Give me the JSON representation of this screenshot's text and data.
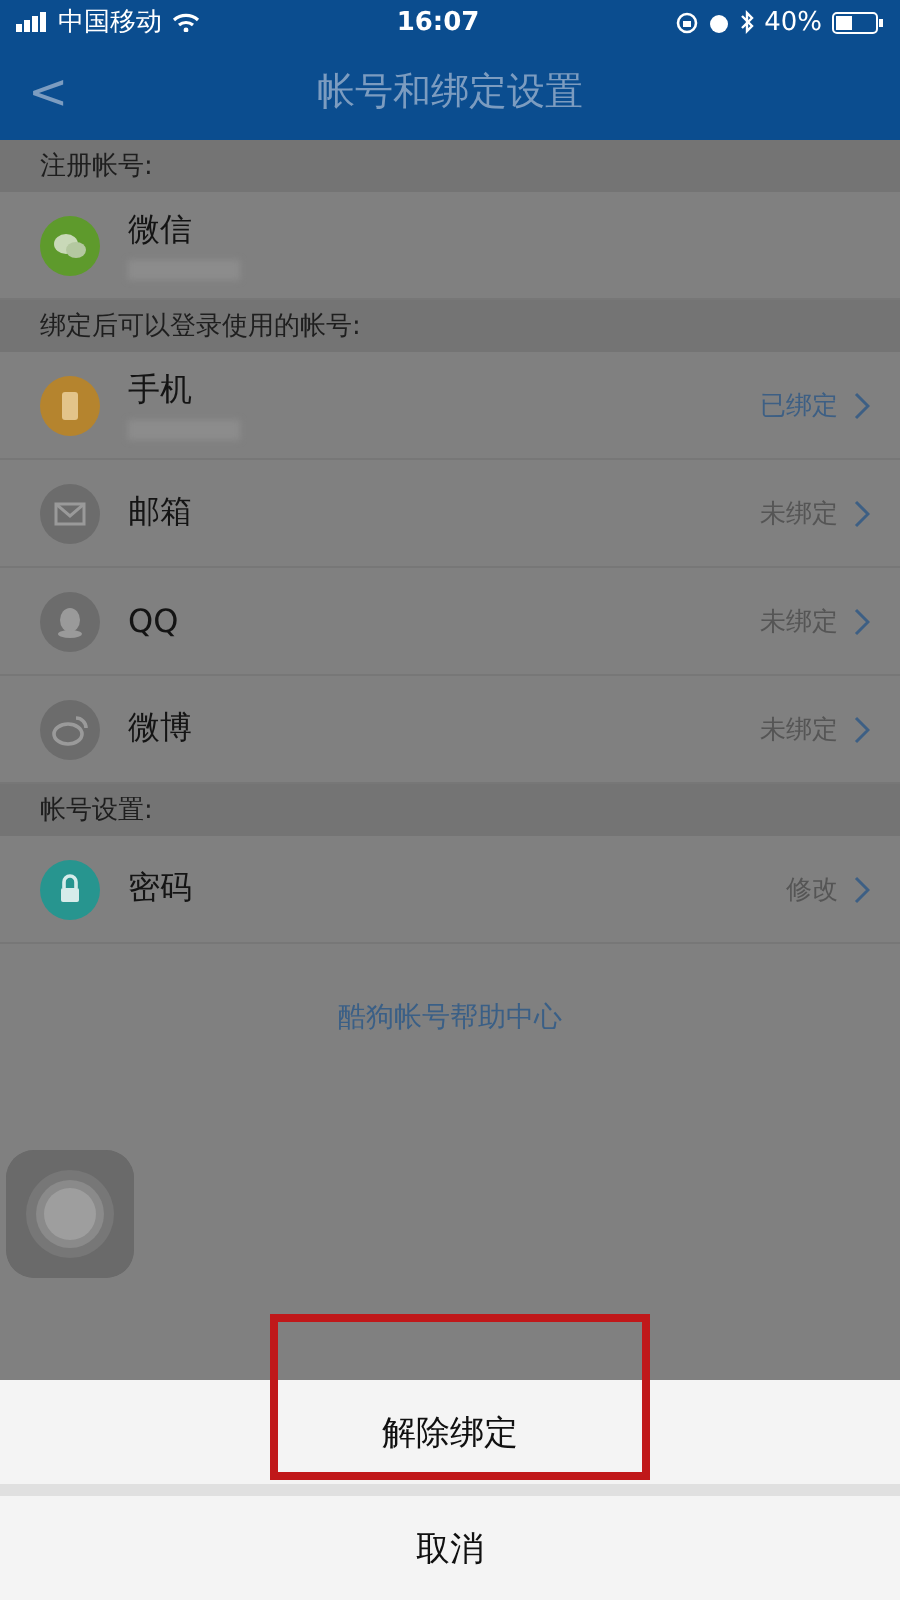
{
  "status_bar": {
    "carrier": "中国移动",
    "time": "16:07",
    "battery": "40%"
  },
  "nav": {
    "back": "<",
    "title": "帐号和绑定设置"
  },
  "sections": [
    {
      "header": "注册帐号:",
      "items": [
        {
          "kind": "wechat",
          "label": "微信",
          "redacted": true
        }
      ]
    },
    {
      "header": "绑定后可以登录使用的帐号:",
      "items": [
        {
          "kind": "phone",
          "label": "手机",
          "redacted": true,
          "status": "已绑定",
          "bound": true
        },
        {
          "kind": "mail",
          "label": "邮箱",
          "status": "未绑定",
          "bound": false
        },
        {
          "kind": "qq",
          "label": "QQ",
          "status": "未绑定",
          "bound": false
        },
        {
          "kind": "weibo",
          "label": "微博",
          "status": "未绑定",
          "bound": false
        }
      ]
    },
    {
      "header": "帐号设置:",
      "items": [
        {
          "kind": "lock",
          "label": "密码",
          "status": "修改",
          "bound": false
        }
      ]
    }
  ],
  "help_link": "酷狗帐号帮助中心",
  "action_sheet": {
    "actions": [
      {
        "label": "解除绑定",
        "highlighted": true
      }
    ],
    "cancel": "取消"
  }
}
